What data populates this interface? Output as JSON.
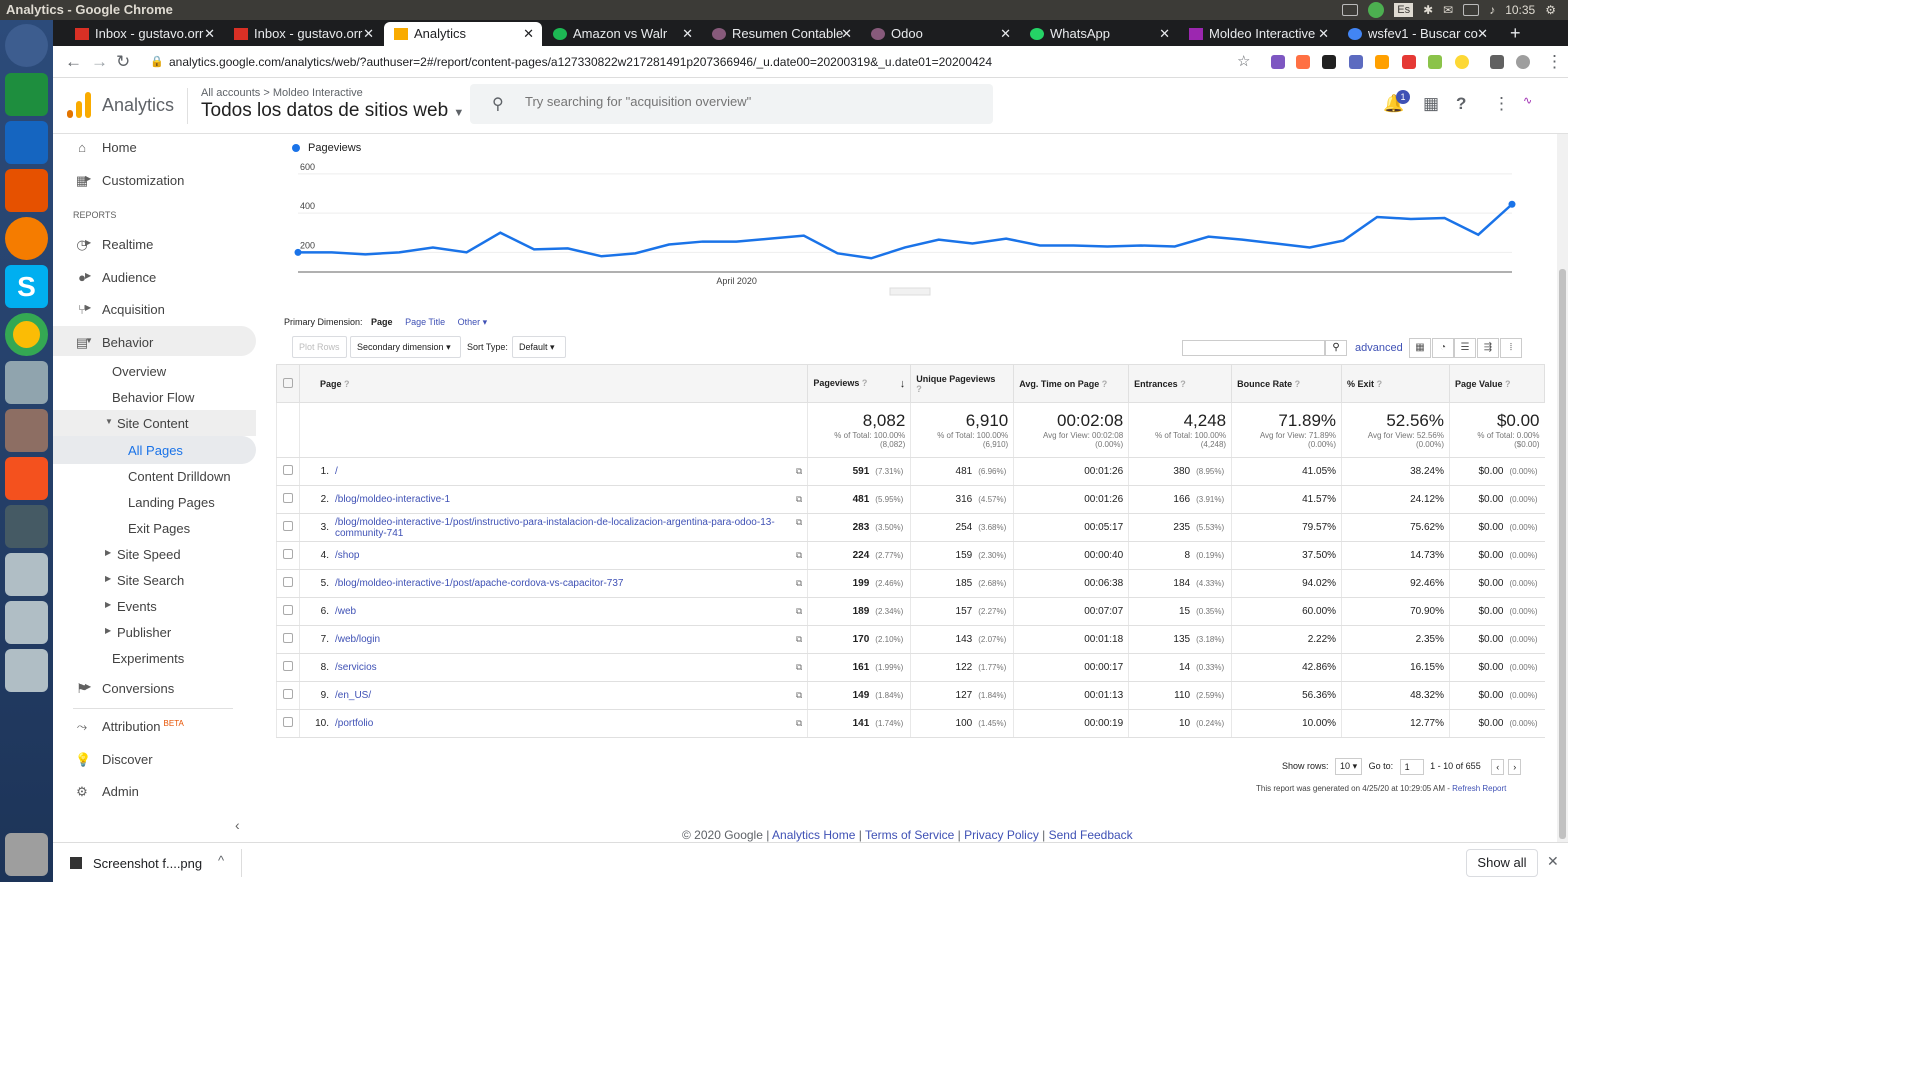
{
  "os": {
    "window_title": "Analytics - Google Chrome",
    "clock": "10:35",
    "keyboard": "Es"
  },
  "tabs": [
    {
      "label": "Inbox - gustavo.orr",
      "color": "#d93025"
    },
    {
      "label": "Inbox - gustavo.orr",
      "color": "#d93025"
    },
    {
      "label": "Analytics",
      "color": "#f9ab00"
    },
    {
      "label": "Amazon vs Walr",
      "color": "#1db954"
    },
    {
      "label": "Resumen Contable",
      "color": "#875a7b"
    },
    {
      "label": "Odoo",
      "color": "#875a7b"
    },
    {
      "label": "WhatsApp",
      "color": "#25d366"
    },
    {
      "label": "Moldeo Interactive",
      "color": "#9c27b0"
    },
    {
      "label": "wsfev1 - Buscar co",
      "color": "#4285f4"
    }
  ],
  "address": {
    "url": "analytics.google.com/analytics/web/?authuser=2#/report/content-pages/a127330822w217281491p207366946/_u.date00=20200319&_u.date01=20200424"
  },
  "header": {
    "app_name": "Analytics",
    "breadcrumb_all": "All accounts",
    "breadcrumb_sep": ">",
    "breadcrumb_account": "Moldeo Interactive",
    "property": "Todos los datos de sitios web",
    "search_placeholder": "Try searching for \"acquisition overview\"",
    "notifications": "1"
  },
  "sidebar": {
    "home": "Home",
    "customization": "Customization",
    "reports_heading": "REPORTS",
    "realtime": "Realtime",
    "audience": "Audience",
    "acquisition": "Acquisition",
    "behavior": "Behavior",
    "overview": "Overview",
    "behavior_flow": "Behavior Flow",
    "site_content": "Site Content",
    "all_pages": "All Pages",
    "content_drilldown": "Content Drilldown",
    "landing_pages": "Landing Pages",
    "exit_pages": "Exit Pages",
    "site_speed": "Site Speed",
    "site_search": "Site Search",
    "events": "Events",
    "publisher": "Publisher",
    "experiments": "Experiments",
    "conversions": "Conversions",
    "attribution": "Attribution",
    "attribution_badge": "BETA",
    "discover": "Discover",
    "admin": "Admin"
  },
  "chart_data": {
    "type": "line",
    "series": [
      {
        "name": "Pageviews",
        "values": [
          200,
          200,
          190,
          200,
          225,
          200,
          300,
          215,
          220,
          180,
          195,
          240,
          255,
          255,
          270,
          285,
          195,
          170,
          225,
          265,
          245,
          270,
          235,
          235,
          230,
          235,
          230,
          280,
          265,
          245,
          225,
          260,
          380,
          370,
          375,
          290,
          445
        ]
      }
    ],
    "yticks": [
      200,
      400,
      600
    ],
    "ylim": [
      100,
      650
    ],
    "xlabel_text": "April 2020",
    "xlabel_index": 13,
    "color": "#1a73e8"
  },
  "controls": {
    "primary_dimension_label": "Primary Dimension:",
    "dim_page": "Page",
    "dim_page_title": "Page Title",
    "dim_other": "Other",
    "plot_rows": "Plot Rows",
    "secondary_dimension": "Secondary dimension",
    "sort_type_label": "Sort Type:",
    "sort_type_value": "Default",
    "advanced": "advanced"
  },
  "table": {
    "headers": {
      "page": "Page",
      "pageviews": "Pageviews",
      "unique": "Unique Pageviews",
      "avg_time": "Avg. Time on Page",
      "entrances": "Entrances",
      "bounce": "Bounce Rate",
      "exit": "% Exit",
      "value": "Page Value"
    },
    "totals": {
      "pageviews": "8,082",
      "pageviews_sub": "% of Total: 100.00% (8,082)",
      "unique": "6,910",
      "unique_sub": "% of Total: 100.00% (6,910)",
      "avg_time": "00:02:08",
      "avg_time_sub": "Avg for View: 00:02:08 (0.00%)",
      "entrances": "4,248",
      "entrances_sub": "% of Total: 100.00% (4,248)",
      "bounce": "71.89%",
      "bounce_sub": "Avg for View: 71.89% (0.00%)",
      "exit": "52.56%",
      "exit_sub": "Avg for View: 52.56% (0.00%)",
      "value": "$0.00",
      "value_sub": "% of Total: 0.00% ($0.00)"
    },
    "rows": [
      {
        "n": "1.",
        "page": "/",
        "pv": "591",
        "pvp": "(7.31%)",
        "upv": "481",
        "upvp": "(6.96%)",
        "time": "00:01:26",
        "ent": "380",
        "entp": "(8.95%)",
        "bounce": "41.05%",
        "exit": "38.24%",
        "val": "$0.00",
        "valp": "(0.00%)"
      },
      {
        "n": "2.",
        "page": "/blog/moldeo-interactive-1",
        "pv": "481",
        "pvp": "(5.95%)",
        "upv": "316",
        "upvp": "(4.57%)",
        "time": "00:01:26",
        "ent": "166",
        "entp": "(3.91%)",
        "bounce": "41.57%",
        "exit": "24.12%",
        "val": "$0.00",
        "valp": "(0.00%)"
      },
      {
        "n": "3.",
        "page": "/blog/moldeo-interactive-1/post/instructivo-para-instalacion-de-localizacion-argentina-para-odoo-13-community-741",
        "pv": "283",
        "pvp": "(3.50%)",
        "upv": "254",
        "upvp": "(3.68%)",
        "time": "00:05:17",
        "ent": "235",
        "entp": "(5.53%)",
        "bounce": "79.57%",
        "exit": "75.62%",
        "val": "$0.00",
        "valp": "(0.00%)"
      },
      {
        "n": "4.",
        "page": "/shop",
        "pv": "224",
        "pvp": "(2.77%)",
        "upv": "159",
        "upvp": "(2.30%)",
        "time": "00:00:40",
        "ent": "8",
        "entp": "(0.19%)",
        "bounce": "37.50%",
        "exit": "14.73%",
        "val": "$0.00",
        "valp": "(0.00%)"
      },
      {
        "n": "5.",
        "page": "/blog/moldeo-interactive-1/post/apache-cordova-vs-capacitor-737",
        "pv": "199",
        "pvp": "(2.46%)",
        "upv": "185",
        "upvp": "(2.68%)",
        "time": "00:06:38",
        "ent": "184",
        "entp": "(4.33%)",
        "bounce": "94.02%",
        "exit": "92.46%",
        "val": "$0.00",
        "valp": "(0.00%)"
      },
      {
        "n": "6.",
        "page": "/web",
        "pv": "189",
        "pvp": "(2.34%)",
        "upv": "157",
        "upvp": "(2.27%)",
        "time": "00:07:07",
        "ent": "15",
        "entp": "(0.35%)",
        "bounce": "60.00%",
        "exit": "70.90%",
        "val": "$0.00",
        "valp": "(0.00%)"
      },
      {
        "n": "7.",
        "page": "/web/login",
        "pv": "170",
        "pvp": "(2.10%)",
        "upv": "143",
        "upvp": "(2.07%)",
        "time": "00:01:18",
        "ent": "135",
        "entp": "(3.18%)",
        "bounce": "2.22%",
        "exit": "2.35%",
        "val": "$0.00",
        "valp": "(0.00%)"
      },
      {
        "n": "8.",
        "page": "/servicios",
        "pv": "161",
        "pvp": "(1.99%)",
        "upv": "122",
        "upvp": "(1.77%)",
        "time": "00:00:17",
        "ent": "14",
        "entp": "(0.33%)",
        "bounce": "42.86%",
        "exit": "16.15%",
        "val": "$0.00",
        "valp": "(0.00%)"
      },
      {
        "n": "9.",
        "page": "/en_US/",
        "pv": "149",
        "pvp": "(1.84%)",
        "upv": "127",
        "upvp": "(1.84%)",
        "time": "00:01:13",
        "ent": "110",
        "entp": "(2.59%)",
        "bounce": "56.36%",
        "exit": "48.32%",
        "val": "$0.00",
        "valp": "(0.00%)"
      },
      {
        "n": "10.",
        "page": "/portfolio",
        "pv": "141",
        "pvp": "(1.74%)",
        "upv": "100",
        "upvp": "(1.45%)",
        "time": "00:00:19",
        "ent": "10",
        "entp": "(0.24%)",
        "bounce": "10.00%",
        "exit": "12.77%",
        "val": "$0.00",
        "valp": "(0.00%)"
      }
    ]
  },
  "paging": {
    "show_rows_label": "Show rows:",
    "show_rows_value": "10",
    "goto_label": "Go to:",
    "goto_value": "1",
    "range": "1 - 10 of 655"
  },
  "report_info": {
    "generated": "This report was generated on 4/25/20 at 10:29:05 AM -",
    "refresh": "Refresh Report"
  },
  "footer": {
    "copyright": "© 2020 Google",
    "links": [
      "Analytics Home",
      "Terms of Service",
      "Privacy Policy",
      "Send Feedback"
    ]
  },
  "download": {
    "filename": "Screenshot f....png",
    "show_all": "Show all"
  }
}
